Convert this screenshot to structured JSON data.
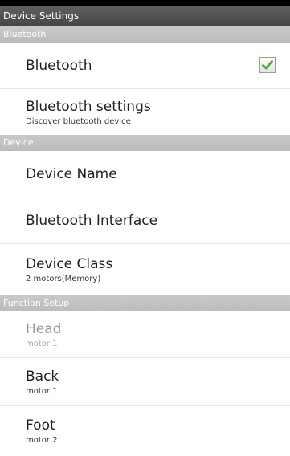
{
  "app": {
    "title": "Device Settings"
  },
  "sections": [
    {
      "header": "Bluetooth",
      "items": [
        {
          "title": "Bluetooth",
          "checked": true
        },
        {
          "title": "Bluetooth settings",
          "summary": "Discover bluetooth device"
        }
      ]
    },
    {
      "header": "Device",
      "items": [
        {
          "title": "Device Name"
        },
        {
          "title": "Bluetooth Interface"
        },
        {
          "title": "Device Class",
          "summary": "2 motors(Memory)"
        }
      ]
    },
    {
      "header": "Function Setup",
      "items": [
        {
          "title": "Head",
          "summary": "motor 1",
          "disabled": true
        },
        {
          "title": "Back",
          "summary": "motor 1"
        },
        {
          "title": "Foot",
          "summary": "motor 2"
        }
      ]
    }
  ],
  "colors": {
    "titlebar": "#4f4f4f",
    "section_header": "#c3c3c3",
    "checkmark": "#4caf2e"
  }
}
